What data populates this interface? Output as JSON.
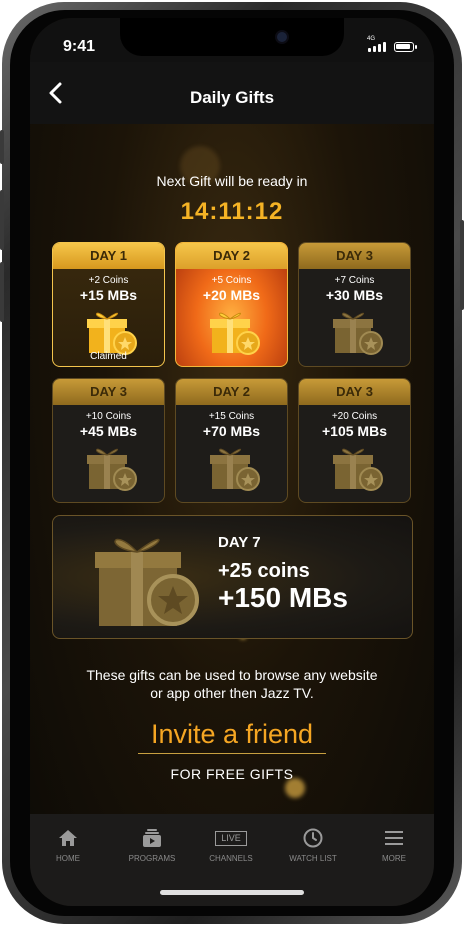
{
  "status_bar": {
    "time": "9:41",
    "network": "4G"
  },
  "header": {
    "title": "Daily Gifts"
  },
  "countdown": {
    "label": "Next Gift will be ready in",
    "time": "14:11:12"
  },
  "gifts": [
    {
      "day": "DAY 1",
      "coins": "+2 Coins",
      "mbs": "+15 MBs",
      "status": "Claimed"
    },
    {
      "day": "DAY 2",
      "coins": "+5 Coins",
      "mbs": "+20 MBs"
    },
    {
      "day": "DAY 3",
      "coins": "+7 Coins",
      "mbs": "+30 MBs"
    },
    {
      "day": "DAY 3",
      "coins": "+10 Coins",
      "mbs": "+45 MBs"
    },
    {
      "day": "DAY 2",
      "coins": "+15 Coins",
      "mbs": "+70 MBs"
    },
    {
      "day": "DAY 3",
      "coins": "+20 Coins",
      "mbs": "+105 MBs"
    }
  ],
  "grand_gift": {
    "day": "DAY 7",
    "coins": "+25 coins",
    "mbs": "+150 MBs"
  },
  "note": "These gifts  can be used to browse any website or app other then Jazz TV.",
  "invite": {
    "label": "Invite a friend",
    "sub": "FOR FREE GIFTS"
  },
  "nav": [
    {
      "label": "HOME",
      "icon": "home-icon"
    },
    {
      "label": "PROGRAMS",
      "icon": "programs-icon"
    },
    {
      "label": "CHANNELS",
      "icon": "live-icon",
      "badge": "LIVE"
    },
    {
      "label": "WATCH LIST",
      "icon": "clock-icon"
    },
    {
      "label": "MORE",
      "icon": "menu-icon"
    }
  ],
  "colors": {
    "accent": "#f5b325",
    "invite": "#f5a623",
    "background": "#1c1408"
  }
}
